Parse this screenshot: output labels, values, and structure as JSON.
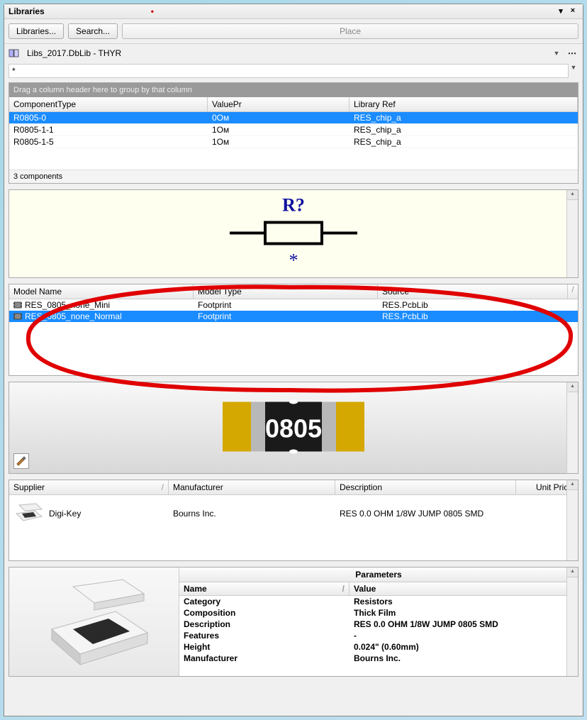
{
  "title": "Libraries",
  "toolbar": {
    "libraries_btn": "Libraries...",
    "search_btn": "Search...",
    "place_btn": "Place"
  },
  "library_selector": "Libs_2017.DbLib - THYR",
  "filter_value": "*",
  "group_hint": "Drag a column header here to group by that column",
  "grid": {
    "headers": {
      "component_type": "ComponentType",
      "value_pr": "ValuePr",
      "library_ref": "Library Ref"
    },
    "rows": [
      {
        "component_type": "R0805-0",
        "value_pr": "0Ом",
        "library_ref": "RES_chip_a",
        "selected": true
      },
      {
        "component_type": "R0805-1-1",
        "value_pr": "1Ом",
        "library_ref": "RES_chip_a",
        "selected": false
      },
      {
        "component_type": "R0805-1-5",
        "value_pr": "1Ом",
        "library_ref": "RES_chip_a",
        "selected": false
      }
    ],
    "count_label": "3 components"
  },
  "schematic": {
    "designator": "R?",
    "comment": "*"
  },
  "models": {
    "headers": {
      "name": "Model Name",
      "type": "Model Type",
      "source": "Source"
    },
    "rows": [
      {
        "name": "RES_0805_none_Mini",
        "type": "Footprint",
        "source": "RES.PcbLib",
        "selected": false
      },
      {
        "name": "RES_0805_none_Normal",
        "type": "Footprint",
        "source": "RES.PcbLib",
        "selected": true
      }
    ]
  },
  "footprint_label": "0805",
  "supplier": {
    "headers": {
      "supplier": "Supplier",
      "manufacturer": "Manufacturer",
      "description": "Description",
      "unit_price": "Unit Price"
    },
    "row": {
      "supplier": "Digi-Key",
      "manufacturer": "Bourns Inc.",
      "description": "RES 0.0 OHM 1/8W JUMP 0805 SMD"
    }
  },
  "parameters": {
    "title": "Parameters",
    "headers": {
      "name": "Name",
      "value": "Value"
    },
    "rows": [
      {
        "name": "Category",
        "value": "Resistors"
      },
      {
        "name": "Composition",
        "value": "Thick Film"
      },
      {
        "name": "Description",
        "value": "RES 0.0 OHM 1/8W JUMP 0805 SMD"
      },
      {
        "name": "Features",
        "value": "-"
      },
      {
        "name": "Height",
        "value": "0.024\" (0.60mm)"
      },
      {
        "name": "Manufacturer",
        "value": "Bourns Inc."
      }
    ]
  }
}
